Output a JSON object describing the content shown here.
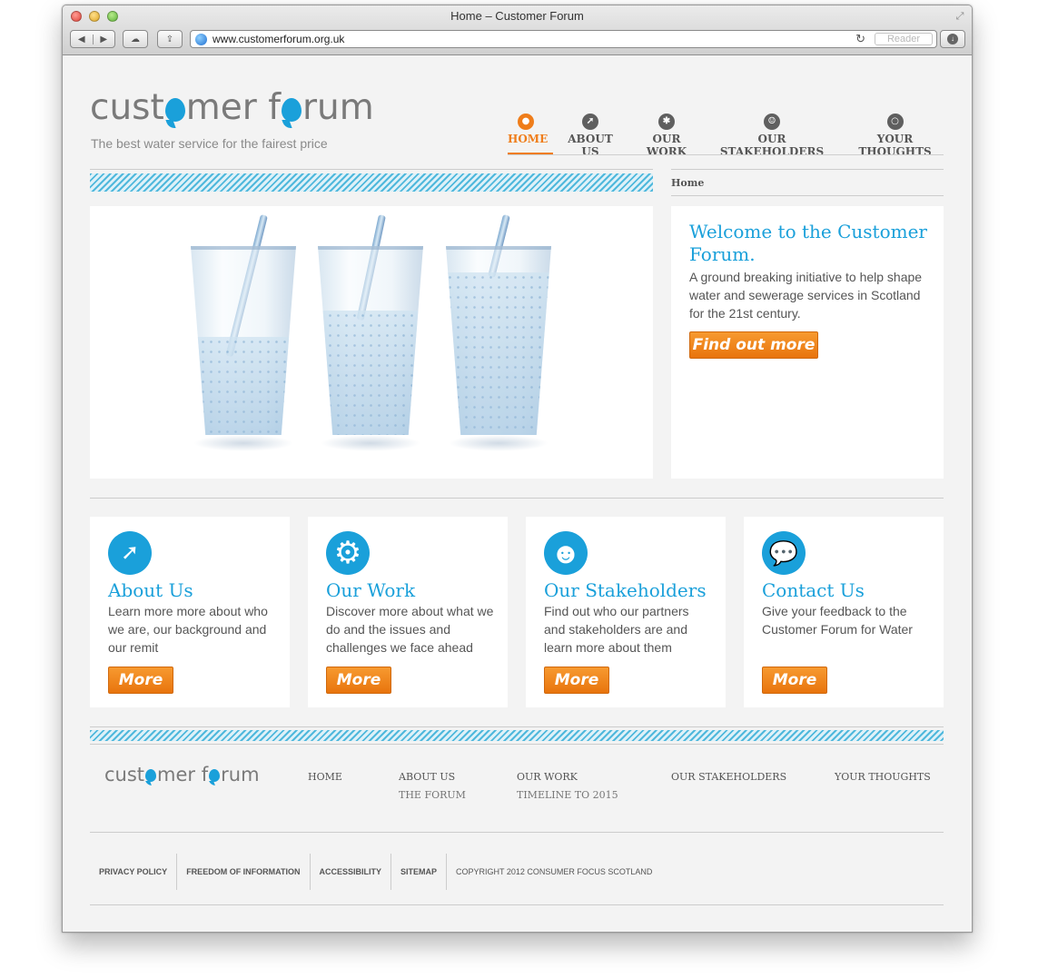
{
  "window": {
    "title": "Home – Customer Forum",
    "url": "www.customerforum.org.uk",
    "reader_label": "Reader"
  },
  "header": {
    "logo_part1": "cust",
    "logo_part2": "mer f",
    "logo_part3": "rum",
    "tagline": "The best water service for the fairest price"
  },
  "nav": {
    "items": [
      {
        "label": "HOME",
        "icon": "pin-icon"
      },
      {
        "label": "ABOUT US",
        "icon": "telescope-icon"
      },
      {
        "label": "OUR WORK",
        "icon": "gear-icon"
      },
      {
        "label": "OUR STAKEHOLDERS",
        "icon": "smiley-icon"
      },
      {
        "label": "YOUR THOUGHTS",
        "icon": "speech-bubble-icon"
      }
    ],
    "active_color": "#ef7d1a"
  },
  "breadcrumb": "Home",
  "welcome": {
    "title": "Welcome to the Customer Forum.",
    "text": "A ground breaking initiative to help shape water and sewerage services in Scotland for the 21st century.",
    "button": "Find out more"
  },
  "cards": [
    {
      "title": "About Us",
      "text": "Learn more more about who we are, our background and our remit",
      "button": "More",
      "icon": "telescope-icon"
    },
    {
      "title": "Our Work",
      "text": "Discover more about what we do and the issues and challenges we face ahead",
      "button": "More",
      "icon": "gear-icon"
    },
    {
      "title": "Our Stakeholders",
      "text": "Find out who our partners and stakeholders are and learn more about them",
      "button": "More",
      "icon": "smiley-icon"
    },
    {
      "title": "Contact Us",
      "text": "Give your feedback to the Customer Forum for Water",
      "button": "More",
      "icon": "speech-bubble-icon"
    }
  ],
  "footer": {
    "nav": {
      "home": "HOME",
      "about": "ABOUT US",
      "about_sub": "THE FORUM",
      "work": "OUR WORK",
      "work_sub": "TIMELINE TO 2015",
      "stakeholders": "OUR STAKEHOLDERS",
      "thoughts": "YOUR THOUGHTS"
    },
    "legal": [
      "PRIVACY POLICY",
      "FREEDOM OF INFORMATION",
      "ACCESSIBILITY",
      "SITEMAP"
    ],
    "copyright": "COPYRIGHT 2012 CONSUMER FOCUS SCOTLAND"
  },
  "colors": {
    "brand_blue": "#1aa0da",
    "button_orange": "#f08417",
    "text_gray": "#555555"
  }
}
